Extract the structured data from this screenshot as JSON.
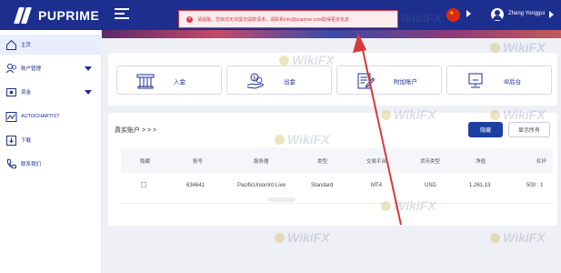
{
  "header": {
    "logo_text": "PUPRIME",
    "error_message": "请提醒。您目前无法提交提款请求。请联系info@puprime.com取得更多信息",
    "user_name": "Zheng Yonggui"
  },
  "sidebar": {
    "items": [
      {
        "label": "主页",
        "icon": "home-icon",
        "active": true
      },
      {
        "label": "账户管理",
        "icon": "accounts-icon",
        "expandable": true
      },
      {
        "label": "资金",
        "icon": "funds-icon",
        "expandable": true
      },
      {
        "label": "AUTOCHARTIST",
        "icon": "chart-icon"
      },
      {
        "label": "下载",
        "icon": "download-icon"
      },
      {
        "label": "联系我们",
        "icon": "phone-icon"
      }
    ]
  },
  "actions": [
    {
      "label": "入金",
      "icon": "deposit-icon"
    },
    {
      "label": "出金",
      "icon": "withdraw-icon"
    },
    {
      "label": "附加账户",
      "icon": "additional-account-icon"
    },
    {
      "label": "IB后台",
      "icon": "ib-portal-icon"
    }
  ],
  "accounts": {
    "title": "真实账户 > > >",
    "hide_label": "隐藏",
    "show_all_label": "显示所有",
    "columns": [
      "隐藏",
      "账号",
      "服务器",
      "类型",
      "交易平台",
      "货币类型",
      "净值",
      "杠杆"
    ],
    "rows": [
      {
        "account": "634641",
        "server": "PacificUnionInt-Live",
        "type": "Standard",
        "platform": "MT4",
        "currency": "USD",
        "equity": "1,261.13",
        "leverage": "500 : 1"
      }
    ]
  },
  "watermark": "WikiFX",
  "colors": {
    "brand": "#1c2f8f",
    "error": "#d83848",
    "arrow": "#d83a3a"
  }
}
